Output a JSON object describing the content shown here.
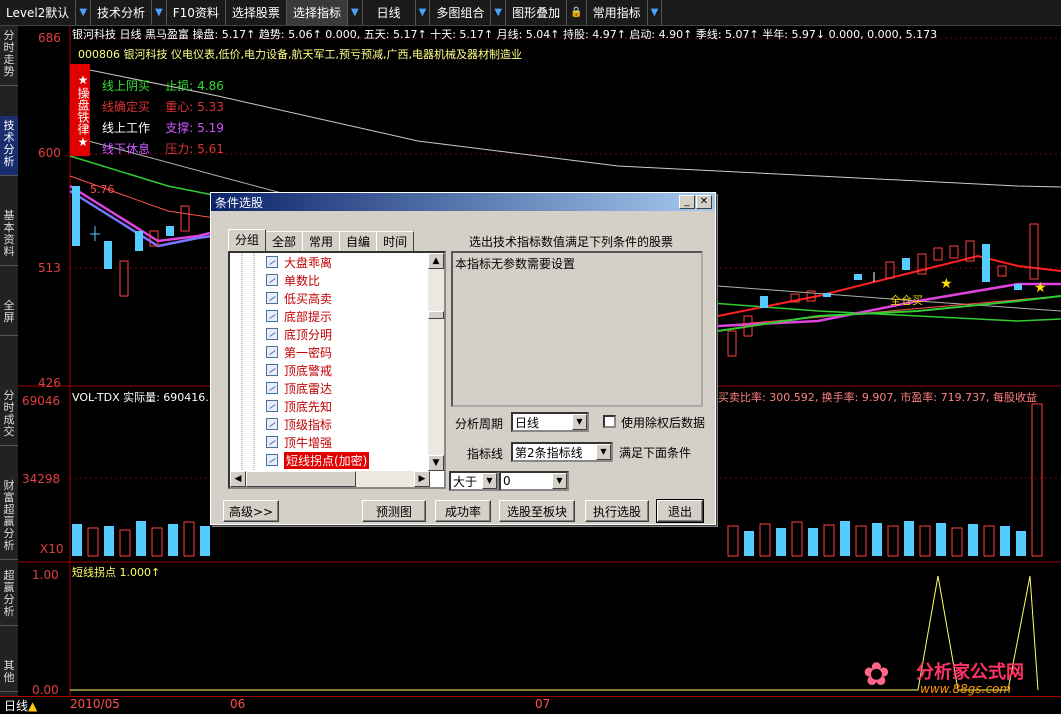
{
  "toolbar": {
    "items": [
      "Level2默认",
      "技术分析",
      "F10资料",
      "选择股票",
      "选择指标",
      "日线",
      "多图组合",
      "图形叠加",
      "常用指标"
    ],
    "active_index": 4
  },
  "sidebar": {
    "tabs": [
      "分时走势",
      "技术分析",
      "基本资料",
      "全屏",
      "分时成交",
      "财富超赢分析",
      "超赢分析",
      "其他"
    ],
    "active_index": 1
  },
  "main_chart": {
    "title_line": "银河科技 日线  黑马盈富  操盘: 5.17↑  趋势: 5.06↑ 0.000, 五天: 5.17↑  十天: 5.17↑  月线: 5.04↑  持股: 4.97↑  启动: 4.90↑  季线: 5.07↑  半年: 5.97↓ 0.000, 0.000, 5.173",
    "stock_info": "000806 银河科技 仪电仪表,低价,电力设备,航天军工,预亏预减,广西,电器机械及器材制造业",
    "badge_text": "★操盘铁律★",
    "rules": [
      {
        "left": "线上阴买",
        "right": "止损: 4.86",
        "color": "#33dd33"
      },
      {
        "left": "线确定买",
        "right": "重心: 5.33",
        "color": "#dd3333"
      },
      {
        "left": "线上工作",
        "right": "支撑: 5.19",
        "color": "#ffffff"
      },
      {
        "left": "线下休息",
        "right": "压力: 5.61",
        "color": "#cc55ff"
      }
    ],
    "y_ticks": [
      "686",
      "600",
      "513",
      "426"
    ],
    "left_value": "5.76",
    "annotation": "全仓买"
  },
  "volume_chart": {
    "title": "VOL-TDX 实际量: 690416.",
    "right_info": "买卖比率: 300.592, 换手率: 9.907, 市盈率: 719.737, 每股收益",
    "y_ticks": [
      "69046",
      "34298",
      "X10"
    ]
  },
  "indicator_chart": {
    "title": "短线拐点  1.000↑",
    "y_ticks": [
      "1.00",
      "0.00"
    ]
  },
  "bottom": {
    "period": "日线",
    "dates": [
      "2010/05",
      "06",
      "07"
    ]
  },
  "watermark": {
    "name": "分析家公式网",
    "url": "www.88gs.com"
  },
  "dialog": {
    "title": "条件选股",
    "tabs": [
      "分组",
      "全部",
      "常用",
      "自编",
      "时间"
    ],
    "active_tab": 0,
    "list_items": [
      "大盘乖离",
      "单数比",
      "低买高卖",
      "底部提示",
      "底顶分明",
      "第一密码",
      "顶底警戒",
      "顶底雷达",
      "顶底先知",
      "顶级指标",
      "顶牛增强",
      "短线拐点(加密)"
    ],
    "selected_index": 11,
    "header": "选出技术指标数值满足下列条件的股票",
    "description": "本指标无参数需要设置",
    "period_label": "分析周期",
    "period_value": "日线",
    "use_adjusted_label": "使用除权后数据",
    "line_label": "指标线",
    "line_value": "第2条指标线",
    "condition_suffix": "满足下面条件",
    "compare_value": "大于",
    "threshold_value": "0",
    "buttons": {
      "advanced": "高级>>",
      "preview": "预测图",
      "success_rate": "成功率",
      "to_block": "选股至板块",
      "execute": "执行选股",
      "exit": "退出"
    }
  }
}
